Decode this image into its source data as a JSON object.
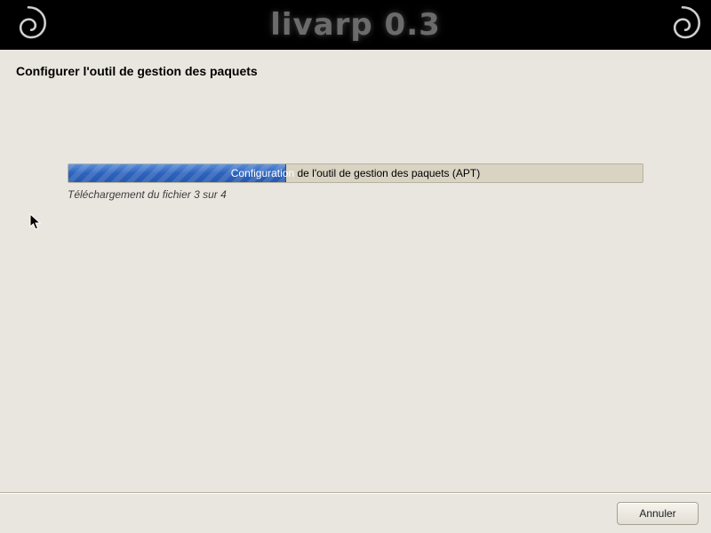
{
  "header": {
    "title": "livarp 0.3"
  },
  "page": {
    "title": "Configurer l'outil de gestion des paquets"
  },
  "progress": {
    "label_left": "Configuration",
    "label_right": " de l'outil de gestion des paquets (APT)",
    "percent": 38,
    "status": "Téléchargement du fichier 3 sur 4",
    "current_file": 3,
    "total_files": 4
  },
  "footer": {
    "cancel_label": "Annuler"
  },
  "colors": {
    "accent": "#2e63bd",
    "background": "#e9e6df"
  }
}
